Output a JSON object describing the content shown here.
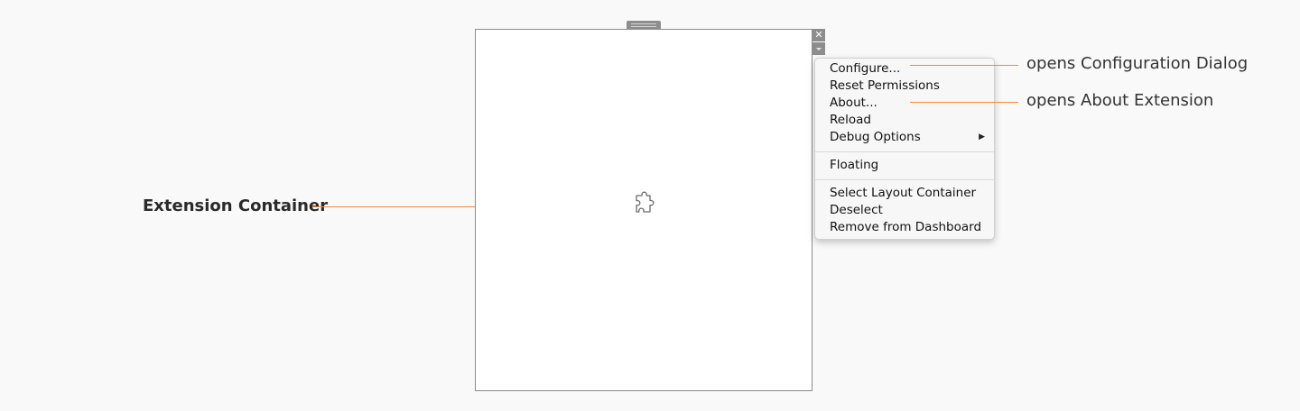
{
  "extension": {
    "close_glyph": "✕",
    "drag_handle_icon": "grip-icon",
    "placeholder_icon": "puzzle-piece-icon",
    "menu_toggle_icon": "chevron-down-icon"
  },
  "context_menu": {
    "group1": [
      {
        "label": "Configure..."
      },
      {
        "label": "Reset Permissions"
      },
      {
        "label": "About..."
      },
      {
        "label": "Reload"
      },
      {
        "label": "Debug Options",
        "submenu_glyph": "▶"
      }
    ],
    "group2": [
      {
        "label": "Floating"
      }
    ],
    "group3": [
      {
        "label": "Select Layout Container"
      },
      {
        "label": "Deselect"
      },
      {
        "label": "Remove from Dashboard"
      }
    ]
  },
  "annotations": {
    "extension_container": "Extension Container",
    "configure_callout": "opens Configuration Dialog",
    "about_callout": "opens About Extension"
  },
  "colors": {
    "accent": "#f08a3c",
    "chrome_gray": "#8d8d8d",
    "page_background": "#f9f9f9"
  }
}
